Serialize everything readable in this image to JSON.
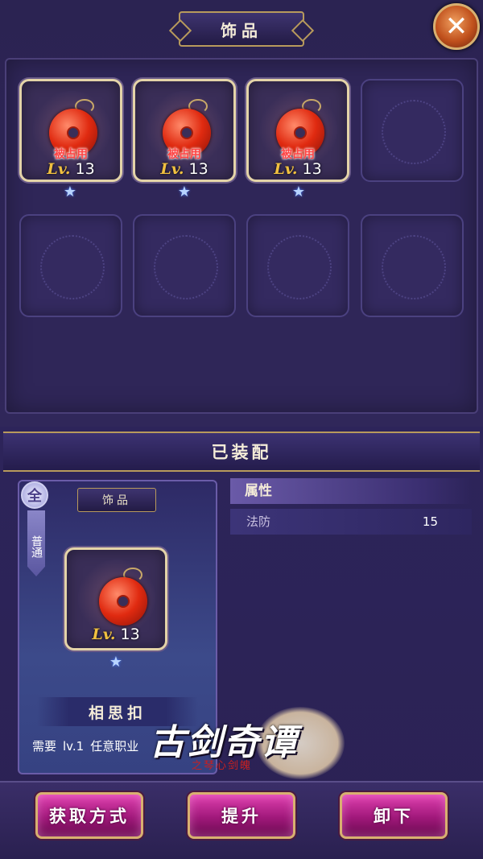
{
  "header": {
    "title": "饰品",
    "close_icon": "close-x-icon"
  },
  "inventory": {
    "slots": [
      {
        "filled": true,
        "status": "被占用",
        "level_prefix": "Lv.",
        "level": "13",
        "stars": 1
      },
      {
        "filled": true,
        "status": "被占用",
        "level_prefix": "Lv.",
        "level": "13",
        "stars": 1
      },
      {
        "filled": true,
        "status": "被占用",
        "level_prefix": "Lv.",
        "level": "13",
        "stars": 1
      },
      {
        "filled": false
      },
      {
        "filled": false
      },
      {
        "filled": false
      },
      {
        "filled": false
      },
      {
        "filled": false
      }
    ]
  },
  "equipped": {
    "title": "已装配",
    "badge": "全",
    "rarity": "普通",
    "category": "饰品",
    "level_prefix": "Lv.",
    "level": "13",
    "stars": 1,
    "name": "相思扣",
    "requirement": {
      "prefix": "需要",
      "level": "lv.1",
      "class": "任意职业"
    }
  },
  "attributes": {
    "header": "属性",
    "rows": [
      {
        "name": "法防",
        "value": "15"
      }
    ]
  },
  "logo": {
    "title": "古剑奇谭",
    "subtitle": "之琴心剑魄"
  },
  "buttons": {
    "obtain": "获取方式",
    "upgrade": "提升",
    "unequip": "卸下"
  },
  "colors": {
    "occupied": "#ff4444",
    "level_prefix": "#f0c040",
    "button": "#c02898",
    "border_gold": "#d8b070"
  }
}
